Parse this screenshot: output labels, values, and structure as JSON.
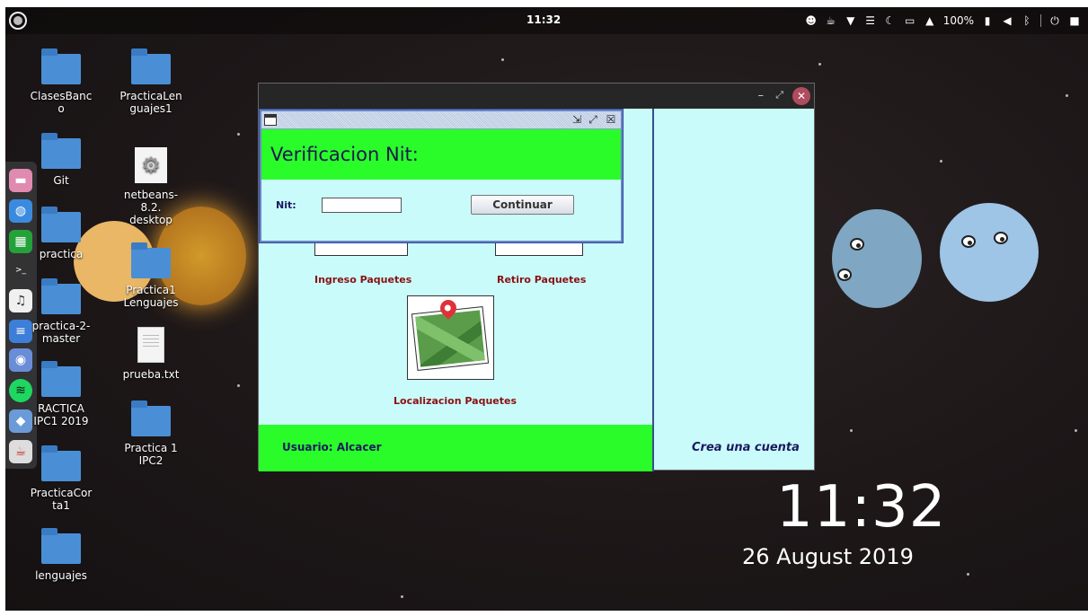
{
  "topbar": {
    "time": "11:32",
    "battery": "100%",
    "tray_icons": [
      "discord-icon",
      "caffeine-icon",
      "wifi-icon",
      "menu-icon",
      "night-light-icon",
      "clipboard-icon",
      "notifications-icon",
      "battery-icon",
      "volume-icon",
      "bluetooth-icon",
      "power-icon",
      "app-indicator-icon"
    ]
  },
  "dock": [
    "files-icon",
    "browser-icon",
    "spreadsheet-icon",
    "terminal-icon",
    "music-icon",
    "text-editor-icon",
    "chrome-icon",
    "spotify-icon",
    "virtualbox-icon",
    "java-icon"
  ],
  "desktop": {
    "icons": [
      {
        "label": "ClasesBanc\no",
        "type": "folder"
      },
      {
        "label": "PracticaLen\nguajes1",
        "type": "folder"
      },
      {
        "label": "Git",
        "type": "folder"
      },
      {
        "label": "netbeans-\n8.2.\ndesktop",
        "type": "gear"
      },
      {
        "label": "practica",
        "type": "folder"
      },
      {
        "label": "Practica1\nLenguajes",
        "type": "folder"
      },
      {
        "label": "practica-2-\nmaster",
        "type": "folder"
      },
      {
        "label": "prueba.txt",
        "type": "text"
      },
      {
        "label": "RACTICA\nIPC1 2019",
        "type": "folder"
      },
      {
        "label": "Practica 1\nIPC2",
        "type": "folder"
      },
      {
        "label": "PracticaCor\nta1",
        "type": "folder"
      },
      {
        "label": "lenguajes",
        "type": "folder"
      }
    ]
  },
  "clock_widget": {
    "time": "11:32",
    "date": "26 August 2019"
  },
  "main_window": {
    "packages": [
      {
        "label": "Ingreso Paquetes"
      },
      {
        "label": "Retiro Paquetes"
      },
      {
        "label": "Localizacion Paquetes"
      }
    ],
    "user_label": "Usuario: Alcacer",
    "create_account": "Crea una cuenta"
  },
  "dialog": {
    "heading": "Verificacion Nit:",
    "nit_label": "Nit:",
    "nit_value": "",
    "continue_label": "Continuar"
  },
  "colors": {
    "accent_green": "#2afc2a",
    "panel_cyan": "#c9fbfb",
    "label_red": "#8b1010",
    "text_navy": "#1a1a5e",
    "close_button": "#b14b60"
  }
}
